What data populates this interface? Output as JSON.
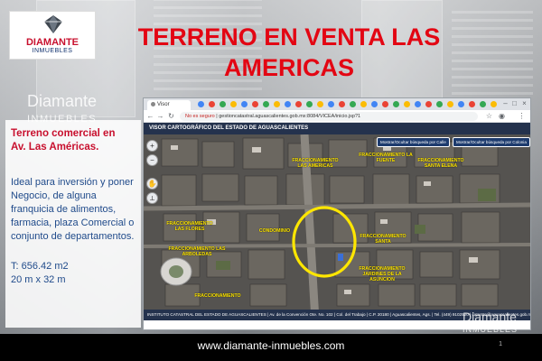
{
  "slide": {
    "title": "TERRENO EN VENTA LAS AMERICAS",
    "logo": {
      "name": "DIAMANTE",
      "sub": "INMUEBLES"
    },
    "watermark": {
      "name": "Diamante",
      "sub": "INMUEBLES"
    },
    "description": {
      "heading_line1": "Terreno comercial en",
      "heading_line2": "Av. Las Américas.",
      "body": "Ideal para inversión y poner Negocio, de alguna franquicia de alimentos, farmacia, plaza Comercial o conjunto de departamentos.",
      "area": "T: 656.42 m2",
      "dimensions": "20 m x 32 m"
    },
    "footer": {
      "url": "www.diamante-inmuebles.com",
      "page_number": "1"
    }
  },
  "browser": {
    "tabs": [
      {
        "label": "Visor cartográfico"
      }
    ],
    "address_insecure": "No es seguro",
    "address_url": "gestioncatastral.aguascalientes.gob.mx:8084/VICEA/inicio.jsp?1",
    "viewer_title": "VISOR CARTOGRÁFICO DEL ESTADO DE AGUASCALIENTES",
    "map_buttons": {
      "calle": "Mostrar/Ocultar búsqueda por Calle",
      "colonia": "Mostrar/Ocultar búsqueda por Colonia"
    },
    "map_footer": "INSTITUTO CATASTRAL DEL ESTADO DE AGUASCALIENTES | Av. de la Convención Ote. No. 102 | Col. del Trabajo | C.P. 20180 | Aguascalientes, Ags. | Tel. (449) 9102520 | catastro@aguascalientes.gob.mx",
    "map_labels": [
      "FRACCIONAMIENTO LAS AMERICAS",
      "FRACCIONAMIENTO LA FUENTE",
      "FRACCIONAMIENTO SANTA ELENA",
      "FRACCIONAMIENTO LAS FLORES",
      "FRACCIONAMIENTO LAS ARBOLEDAS",
      "FRACCIONAMIENTO JARDINES DE LA ASUNCION",
      "FRACCIONAMIENTO SANTA",
      "CONDOMINIO",
      "FRACCIONAMIENTO"
    ]
  },
  "colors": {
    "title_red": "#e30613",
    "text_blue": "#1f4a8a",
    "highlight_circle": "#ffe600",
    "viewer_navy": "#24324d"
  },
  "icons": [
    "diamond-logo-icon",
    "zoom-in-icon",
    "zoom-out-icon",
    "pan-hand-icon",
    "back-icon",
    "forward-icon",
    "reload-icon",
    "menu-icon"
  ]
}
